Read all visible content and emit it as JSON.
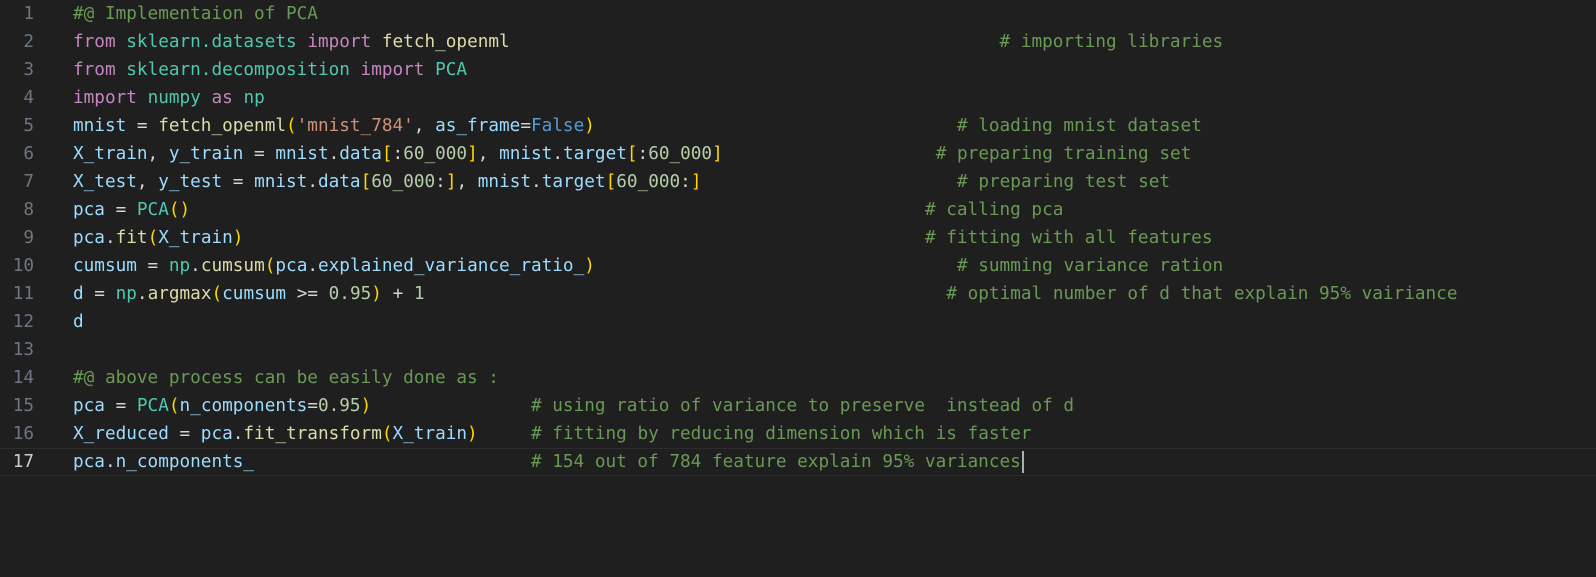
{
  "editor": {
    "active_line": 17,
    "language": "python",
    "lines": [
      {
        "number": "1",
        "tokens": [
          [
            "cmt",
            "#@ Implementaion of PCA"
          ]
        ]
      },
      {
        "number": "2",
        "tokens": [
          [
            "kw",
            "from"
          ],
          [
            "op",
            " "
          ],
          [
            "mod",
            "sklearn.datasets"
          ],
          [
            "op",
            " "
          ],
          [
            "kw",
            "import"
          ],
          [
            "op",
            " "
          ],
          [
            "fn",
            "fetch_openml"
          ],
          [
            "op",
            "                                              "
          ],
          [
            "cmt",
            "# importing libraries"
          ]
        ]
      },
      {
        "number": "3",
        "tokens": [
          [
            "kw",
            "from"
          ],
          [
            "op",
            " "
          ],
          [
            "mod",
            "sklearn.decomposition"
          ],
          [
            "op",
            " "
          ],
          [
            "kw",
            "import"
          ],
          [
            "op",
            " "
          ],
          [
            "mod",
            "PCA"
          ]
        ]
      },
      {
        "number": "4",
        "tokens": [
          [
            "kw",
            "import"
          ],
          [
            "op",
            " "
          ],
          [
            "mod",
            "numpy"
          ],
          [
            "op",
            " "
          ],
          [
            "kw",
            "as"
          ],
          [
            "op",
            " "
          ],
          [
            "mod",
            "np"
          ]
        ]
      },
      {
        "number": "5",
        "tokens": [
          [
            "var",
            "mnist"
          ],
          [
            "op",
            " = "
          ],
          [
            "fn",
            "fetch_openml"
          ],
          [
            "b1",
            "("
          ],
          [
            "str",
            "'mnist_784'"
          ],
          [
            "op",
            ", "
          ],
          [
            "var",
            "as_frame"
          ],
          [
            "op",
            "="
          ],
          [
            "cst",
            "False"
          ],
          [
            "b1",
            ")"
          ],
          [
            "op",
            "                                  "
          ],
          [
            "cmt",
            "# loading mnist dataset"
          ]
        ]
      },
      {
        "number": "6",
        "tokens": [
          [
            "var",
            "X_train"
          ],
          [
            "op",
            ", "
          ],
          [
            "var",
            "y_train"
          ],
          [
            "op",
            " = "
          ],
          [
            "var",
            "mnist"
          ],
          [
            "op",
            "."
          ],
          [
            "var",
            "data"
          ],
          [
            "b1",
            "["
          ],
          [
            "op",
            ":"
          ],
          [
            "num",
            "60_000"
          ],
          [
            "b1",
            "]"
          ],
          [
            "op",
            ", "
          ],
          [
            "var",
            "mnist"
          ],
          [
            "op",
            "."
          ],
          [
            "var",
            "target"
          ],
          [
            "b1",
            "["
          ],
          [
            "op",
            ":"
          ],
          [
            "num",
            "60_000"
          ],
          [
            "b1",
            "]"
          ],
          [
            "op",
            "                    "
          ],
          [
            "cmt",
            "# preparing training set"
          ]
        ]
      },
      {
        "number": "7",
        "tokens": [
          [
            "var",
            "X_test"
          ],
          [
            "op",
            ", "
          ],
          [
            "var",
            "y_test"
          ],
          [
            "op",
            " = "
          ],
          [
            "var",
            "mnist"
          ],
          [
            "op",
            "."
          ],
          [
            "var",
            "data"
          ],
          [
            "b1",
            "["
          ],
          [
            "num",
            "60_000"
          ],
          [
            "op",
            ":"
          ],
          [
            "b1",
            "]"
          ],
          [
            "op",
            ", "
          ],
          [
            "var",
            "mnist"
          ],
          [
            "op",
            "."
          ],
          [
            "var",
            "target"
          ],
          [
            "b1",
            "["
          ],
          [
            "num",
            "60_000"
          ],
          [
            "op",
            ":"
          ],
          [
            "b1",
            "]"
          ],
          [
            "op",
            "                        "
          ],
          [
            "cmt",
            "# preparing test set"
          ]
        ]
      },
      {
        "number": "8",
        "tokens": [
          [
            "var",
            "pca"
          ],
          [
            "op",
            " = "
          ],
          [
            "mod",
            "PCA"
          ],
          [
            "b1",
            "()"
          ],
          [
            "op",
            "                                                                     "
          ],
          [
            "cmt",
            "# calling pca"
          ]
        ]
      },
      {
        "number": "9",
        "tokens": [
          [
            "var",
            "pca"
          ],
          [
            "op",
            "."
          ],
          [
            "fn",
            "fit"
          ],
          [
            "b1",
            "("
          ],
          [
            "var",
            "X_train"
          ],
          [
            "b1",
            ")"
          ],
          [
            "op",
            "                                                                "
          ],
          [
            "cmt",
            "# fitting with all features"
          ]
        ]
      },
      {
        "number": "10",
        "tokens": [
          [
            "var",
            "cumsum"
          ],
          [
            "op",
            " = "
          ],
          [
            "mod",
            "np"
          ],
          [
            "op",
            "."
          ],
          [
            "fn",
            "cumsum"
          ],
          [
            "b1",
            "("
          ],
          [
            "var",
            "pca"
          ],
          [
            "op",
            "."
          ],
          [
            "var",
            "explained_variance_ratio_"
          ],
          [
            "b1",
            ")"
          ],
          [
            "op",
            "                                  "
          ],
          [
            "cmt",
            "# summing variance ration"
          ]
        ]
      },
      {
        "number": "11",
        "tokens": [
          [
            "var",
            "d"
          ],
          [
            "op",
            " = "
          ],
          [
            "mod",
            "np"
          ],
          [
            "op",
            "."
          ],
          [
            "fn",
            "argmax"
          ],
          [
            "b1",
            "("
          ],
          [
            "var",
            "cumsum"
          ],
          [
            "op",
            " >= "
          ],
          [
            "num",
            "0.95"
          ],
          [
            "b1",
            ")"
          ],
          [
            "op",
            " + "
          ],
          [
            "num",
            "1"
          ],
          [
            "op",
            "                                                 "
          ],
          [
            "cmt",
            "# optimal number of d that explain 95% vairiance"
          ]
        ]
      },
      {
        "number": "12",
        "tokens": [
          [
            "var",
            "d"
          ]
        ]
      },
      {
        "number": "13",
        "tokens": []
      },
      {
        "number": "14",
        "tokens": [
          [
            "cmt",
            "#@ above process can be easily done as :"
          ]
        ]
      },
      {
        "number": "15",
        "tokens": [
          [
            "var",
            "pca"
          ],
          [
            "op",
            " = "
          ],
          [
            "mod",
            "PCA"
          ],
          [
            "b1",
            "("
          ],
          [
            "var",
            "n_components"
          ],
          [
            "op",
            "="
          ],
          [
            "num",
            "0.95"
          ],
          [
            "b1",
            ")"
          ],
          [
            "op",
            "               "
          ],
          [
            "cmt",
            "# using ratio of variance to preserve  instead of d"
          ]
        ]
      },
      {
        "number": "16",
        "tokens": [
          [
            "var",
            "X_reduced"
          ],
          [
            "op",
            " = "
          ],
          [
            "var",
            "pca"
          ],
          [
            "op",
            "."
          ],
          [
            "fn",
            "fit_transform"
          ],
          [
            "b1",
            "("
          ],
          [
            "var",
            "X_train"
          ],
          [
            "b1",
            ")"
          ],
          [
            "op",
            "     "
          ],
          [
            "cmt",
            "# fitting by reducing dimension which is faster"
          ]
        ]
      },
      {
        "number": "17",
        "tokens": [
          [
            "var",
            "pca"
          ],
          [
            "op",
            "."
          ],
          [
            "var",
            "n_components_"
          ],
          [
            "op",
            "                          "
          ],
          [
            "cmt",
            "# 154 out of 784 feature explain 95% variances"
          ]
        ]
      }
    ]
  }
}
